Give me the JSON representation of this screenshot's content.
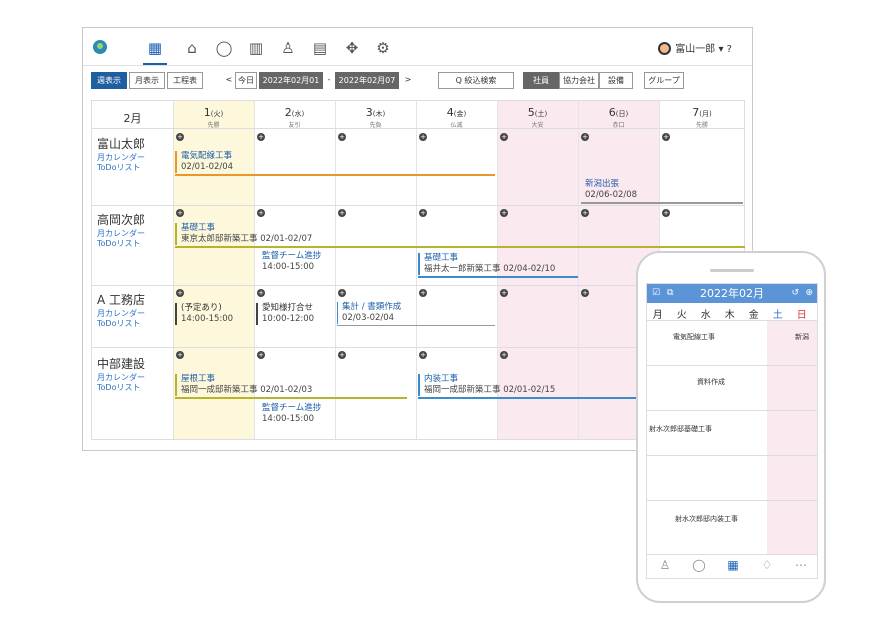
{
  "nav": {
    "icons": [
      "calendar-icon",
      "home-icon",
      "chat-icon",
      "book-icon",
      "people-icon",
      "document-icon",
      "cross-arrow-icon",
      "gear-icon"
    ]
  },
  "user": {
    "name": "富山一郎",
    "menu": "▾ ?"
  },
  "toolbar": {
    "week": "週表示",
    "month": "月表示",
    "process": "工程表",
    "prev": "<",
    "today": "今日",
    "start": "2022年02月01日",
    "dash": "-",
    "end": "2022年02月07日",
    "next": ">",
    "search": "Q 絞込検索",
    "staff": "社員",
    "partner": "協力会社",
    "equipment": "設備",
    "group": "グループ"
  },
  "grid": {
    "month": "2月",
    "days": [
      {
        "n": "1",
        "w": "(火)",
        "r": "先勝"
      },
      {
        "n": "2",
        "w": "(水)",
        "r": "友引"
      },
      {
        "n": "3",
        "w": "(木)",
        "r": "先負"
      },
      {
        "n": "4",
        "w": "(金)",
        "r": "仏滅"
      },
      {
        "n": "5",
        "w": "(土)",
        "r": "大安"
      },
      {
        "n": "6",
        "w": "(日)",
        "r": "赤口"
      },
      {
        "n": "7",
        "w": "(月)",
        "r": "先勝"
      }
    ]
  },
  "rows": [
    {
      "name": "富山太郎",
      "l1": "月カレンダー",
      "l2": "ToDoリスト"
    },
    {
      "name": "高岡次郎",
      "l1": "月カレンダー",
      "l2": "ToDoリスト"
    },
    {
      "name": "A 工務店",
      "l1": "月カレンダー",
      "l2": "ToDoリスト"
    },
    {
      "name": "中部建設",
      "l1": "月カレンダー",
      "l2": "ToDoリスト"
    }
  ],
  "events": {
    "e1t": "電気配線工事",
    "e1d": "02/01-02/04",
    "e2t": "新潟出張",
    "e2d": "02/06-02/08",
    "e3t": "基礎工事",
    "e3d": "東京太郎邸新築工事 02/01-02/07",
    "e4t": "監督チーム進捗",
    "e4d": "14:00-15:00",
    "e5t": "基礎工事",
    "e5d": "福井太一郎新築工事 02/04-02/10",
    "e6t": "(予定あり)",
    "e6d": "14:00-15:00",
    "e7t": "愛知様打合せ",
    "e7d": "10:00-12:00",
    "e8t": "集計 / 書類作成",
    "e8d": "02/03-02/04",
    "e9t": "屋根工事",
    "e9d": "福岡一成邸新築工事 02/01-02/03",
    "e10t": "内装工事",
    "e10d": "福岡一成邸新築工事 02/01-02/15",
    "e11t": "監督チーム進捗",
    "e11d": "14:00-15:00"
  },
  "phone": {
    "title": "2022年02月",
    "weekdays": [
      "月",
      "火",
      "水",
      "木",
      "金",
      "土",
      "日"
    ],
    "ev1": "電気配線工事",
    "ev2": "新潟",
    "ev3": "資料作成",
    "ev4": "射水次郎邸基礎工事",
    "ev5": "射水次郎邸内装工事"
  },
  "colors": {
    "accent": "#1a5fb4",
    "saturday": "#fbe9f0",
    "today": "#fdf8dc"
  }
}
